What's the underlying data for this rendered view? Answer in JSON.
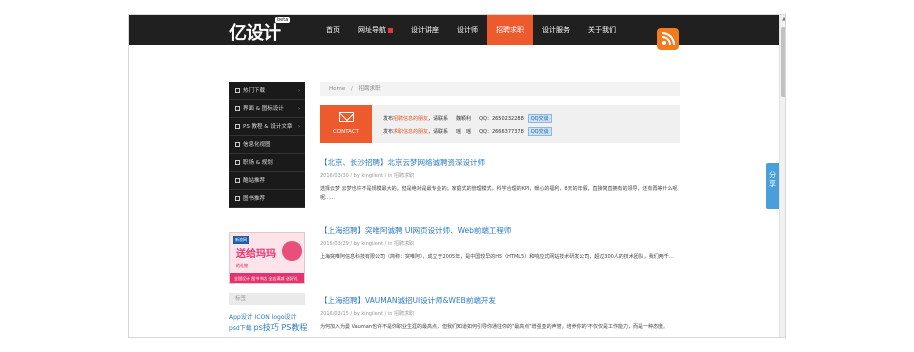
{
  "header": {
    "logo_text": "亿设计",
    "logo_tag": "beta",
    "nav": [
      {
        "label": "首页",
        "active": false,
        "hot": false
      },
      {
        "label": "网址导航",
        "active": false,
        "hot": true
      },
      {
        "label": "设计讲座",
        "active": false,
        "hot": false
      },
      {
        "label": "设计师",
        "active": false,
        "hot": false
      },
      {
        "label": "招聘求职",
        "active": true,
        "hot": false
      },
      {
        "label": "设计服务",
        "active": false,
        "hot": false
      },
      {
        "label": "关于我们",
        "active": false,
        "hot": false
      }
    ],
    "rss_icon": "rss-icon"
  },
  "share_tab": {
    "label": "分享"
  },
  "sidebar": {
    "items": [
      {
        "label": "热门下载",
        "icon": "download-icon"
      },
      {
        "label": "界面 & 图标设计",
        "icon": "ui-icon"
      },
      {
        "label": "PS 教程 & 设计文章",
        "icon": "ps-icon"
      },
      {
        "label": "信息化视图",
        "icon": "chart-icon"
      },
      {
        "label": "职场 & 规划",
        "icon": "briefcase-icon"
      },
      {
        "label": "酷站推荐",
        "icon": "site-icon"
      },
      {
        "label": "图书推荐",
        "icon": "book-icon"
      }
    ],
    "ad": {
      "logo": "新浪网",
      "headline": "送给玛玛",
      "sub": "的礼物",
      "bar": "全国设计 图书书店 全店满减 送好礼"
    },
    "tags_title": "标签",
    "tags_line1": "App设计 ICON logo设计",
    "tags_line2_a": "psd下载",
    "tags_line2_b": "ps技巧 PS教程"
  },
  "breadcrumb": {
    "home": "Home",
    "separator": "/",
    "current": "招聘求职"
  },
  "contact": {
    "button_label": "CONTACT",
    "line1": {
      "prefix": "发布",
      "highlight": "招聘信息的朋友",
      "suffix": "，请联系",
      "name": "魏颖利",
      "qq_label": "QQ：",
      "qq": "2650232288",
      "qq_button": "QQ交谈"
    },
    "line2": {
      "prefix": "发布",
      "highlight": "求职信息的朋友",
      "suffix": "，请联系",
      "name": "瑶　瑶",
      "qq_label": "QQ：",
      "qq": "2666377378",
      "qq_button": "QQ交谈"
    }
  },
  "articles": [
    {
      "title": "【北京、长沙招聘】北京云梦网络诚聘资深设计师",
      "meta": "2016/03/30 / by kingilent / in 招聘求职",
      "body": "选择云梦 云梦也许不是规模最大的，但是绝对是最专业的；家庭式的管理模式，科学合理的KPI，暖心的福利，8天的年假，直接简直拥有的领导，还有再等什么呢呢……"
    },
    {
      "title": "【上海招聘】突唯阿诚聘 UI网页设计师、Web前端工程师",
      "meta": "2016/03/29 / by kingilent / in 招聘求职",
      "body": "上海突唯阿信息科技有限公司（简称：突唯阿），成立于2005年，是中国较早的H5（HTML5）和响应式网站技术研发公司，超过300人的技术团队，我们两千…"
    },
    {
      "title": "【上海招聘】VAUMAN诚招UI设计师&WEB前端开发",
      "meta": "2016/03/15 / by kingilent / in 招聘求职",
      "body": "为何加入为曼 Vauman也许不是你职业生涯的最高点，但我们知道如何引导你通往你的\"最高点\"增强亚的声誉，培养你的'不仅仅是工作能力，而是一种态度。"
    }
  ]
}
